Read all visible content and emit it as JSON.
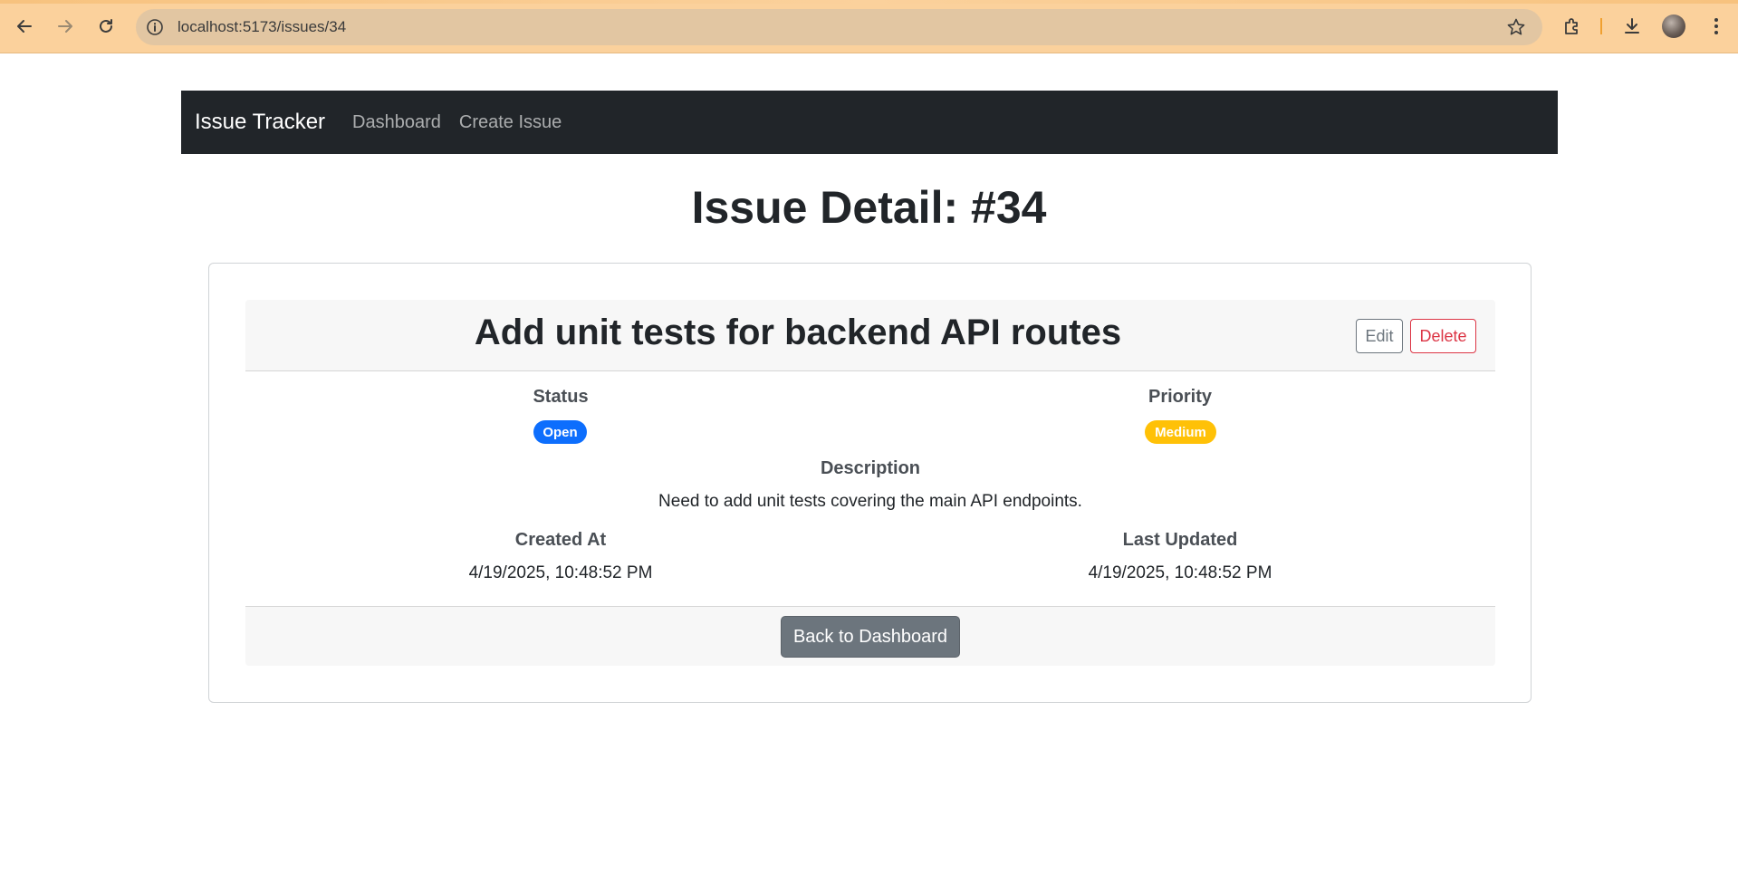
{
  "browser": {
    "url": "localhost:5173/issues/34",
    "icons": [
      "back-arrow-icon",
      "forward-arrow-icon",
      "reload-icon",
      "site-info-icon",
      "bookmark-star-icon",
      "extensions-icon",
      "download-icon",
      "profile-avatar",
      "menu-dots-icon"
    ]
  },
  "navbar": {
    "brand": "Issue Tracker",
    "links": [
      "Dashboard",
      "Create Issue"
    ]
  },
  "page": {
    "title": "Issue Detail: #34"
  },
  "issue": {
    "title": "Add unit tests for backend API routes",
    "edit_label": "Edit",
    "delete_label": "Delete",
    "status_label": "Status",
    "status_value": "Open",
    "priority_label": "Priority",
    "priority_value": "Medium",
    "description_label": "Description",
    "description": "Need to add unit tests covering the main API endpoints.",
    "created_label": "Created At",
    "created_value": "4/19/2025, 10:48:52 PM",
    "updated_label": "Last Updated",
    "updated_value": "4/19/2025, 10:48:52 PM",
    "back_label": "Back to Dashboard"
  },
  "colors": {
    "navbar_bg": "#212529",
    "status_open": "#0d6efd",
    "priority_medium": "#ffc107",
    "danger": "#dc3545",
    "secondary": "#6c757d",
    "chrome_bg": "#fbd19c"
  }
}
